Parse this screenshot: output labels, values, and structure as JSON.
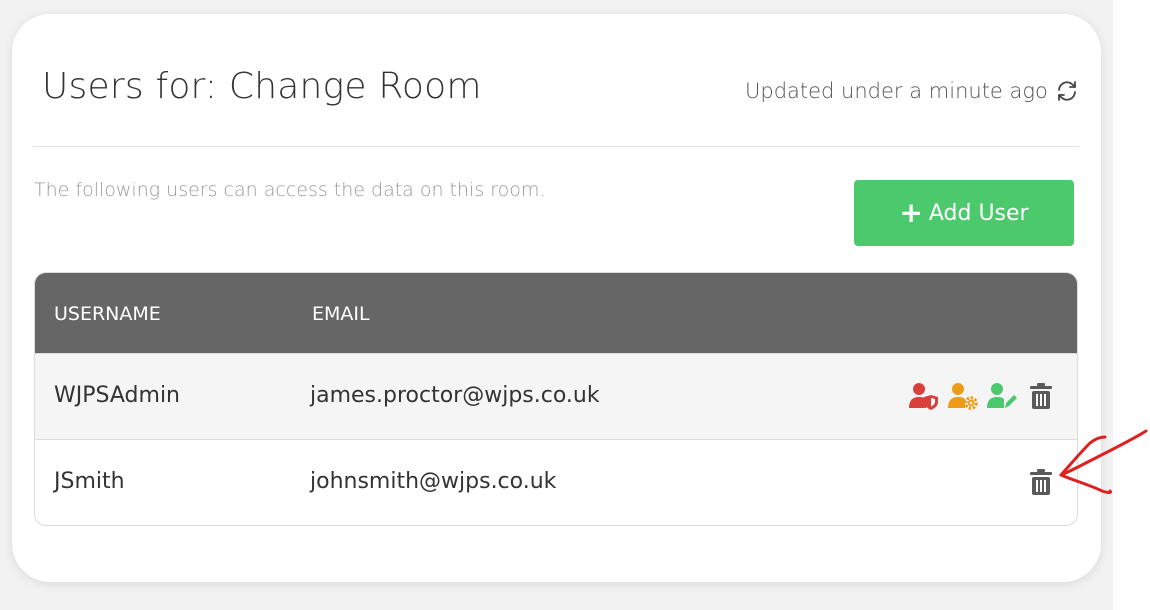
{
  "header": {
    "title": "Users for: Change Room",
    "updated": "Updated under a minute ago",
    "refresh_icon": "refresh-icon"
  },
  "description": "The following users can access the data on this room.",
  "add_button": {
    "label": "Add User",
    "icon": "plus-icon",
    "color": "#4cc96d"
  },
  "table": {
    "columns": [
      "USERNAME",
      "EMAIL"
    ],
    "header_color": "#666666",
    "rows": [
      {
        "username": "WJPSAdmin",
        "email": "james.proctor@wjps.co.uk",
        "actions": [
          "user-shield-icon",
          "user-cog-icon",
          "user-edit-icon",
          "trash-icon"
        ]
      },
      {
        "username": "JSmith",
        "email": "johnsmith@wjps.co.uk",
        "actions": [
          "trash-icon"
        ]
      }
    ]
  },
  "colors": {
    "admin_red": "#d9403a",
    "settings_orange": "#ee9b1a",
    "edit_green": "#4cc96d",
    "trash_gray": "#5a5a5a",
    "annotation_red": "#e02020"
  }
}
